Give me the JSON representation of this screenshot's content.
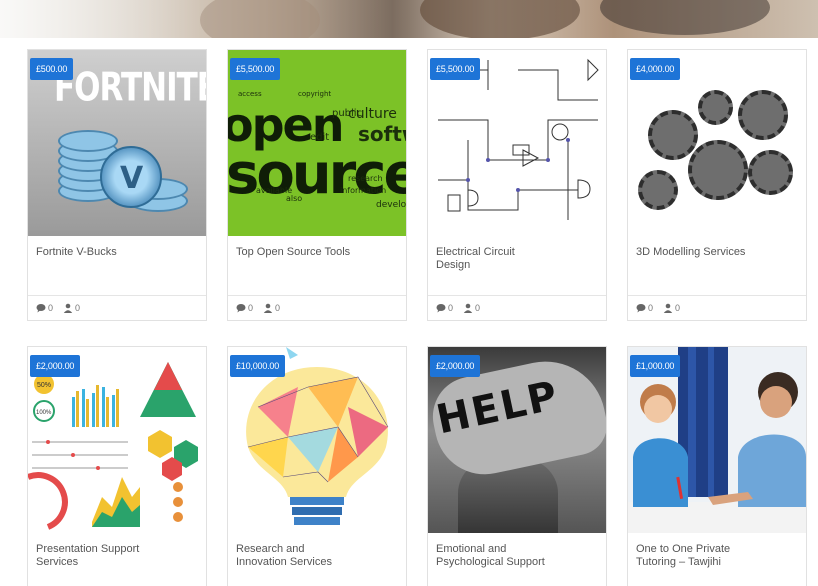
{
  "cards": [
    {
      "price": "£500.00",
      "title": "Fortnite V-Bucks",
      "comments": "0",
      "users": "0",
      "thumb": "fortnite-vbucks-image",
      "logo_text": "FORTNITE"
    },
    {
      "price": "£5,500.00",
      "title": "Top Open Source Tools",
      "comments": "0",
      "users": "0",
      "thumb": "open-source-wordcloud-image",
      "words": [
        "open",
        "source",
        "culture",
        "software",
        "public",
        "edit",
        "copyright",
        "available",
        "information",
        "development",
        "research",
        "also",
        "access"
      ]
    },
    {
      "price": "£5,500.00",
      "title": "Electrical Circuit\nDesign",
      "comments": "0",
      "users": "0",
      "thumb": "circuit-diagram-image"
    },
    {
      "price": "£4,000.00",
      "title": "3D Modelling Services",
      "comments": "0",
      "users": "0",
      "thumb": "3d-gear-model-image"
    },
    {
      "price": "£2,000.00",
      "title": "Presentation Support\nServices",
      "thumb": "infographic-charts-image",
      "badges": [
        "50%",
        "100%"
      ]
    },
    {
      "price": "£10,000.00",
      "title": "Research and\nInnovation Services",
      "thumb": "lightbulb-illustration-image"
    },
    {
      "price": "£2,000.00",
      "title": "Emotional and\nPsychological Support",
      "thumb": "help-hand-image",
      "hand_text": "HELP"
    },
    {
      "price": "£1,000.00",
      "title": "One to One Private\nTutoring – Tawjihi",
      "thumb": "tutoring-photo-image"
    }
  ],
  "icons": {
    "comment": "comment-icon",
    "user": "user-icon"
  },
  "colors": {
    "price_badge": "#1e74d7",
    "border": "#e1e1e1"
  }
}
